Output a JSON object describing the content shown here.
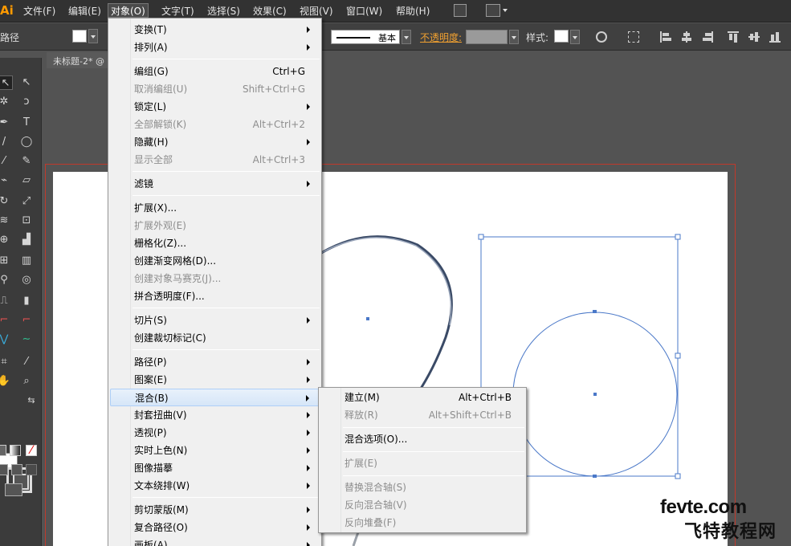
{
  "app": {
    "logo": "Ai"
  },
  "menubar": {
    "items": [
      "文件(F)",
      "编辑(E)",
      "对象(O)",
      "文字(T)",
      "选择(S)",
      "效果(C)",
      "视图(V)",
      "窗口(W)",
      "帮助(H)"
    ],
    "active": "对象(O)"
  },
  "controlbar": {
    "left_label": "路径",
    "stroke_style": "基本",
    "opacity_label": "不透明度:",
    "style_label": "样式:"
  },
  "document": {
    "tab_title": "未标题-2* @"
  },
  "object_menu": {
    "items": [
      {
        "label": "变换(T)",
        "shortcut": "",
        "submenu": true,
        "disabled": false
      },
      {
        "label": "排列(A)",
        "shortcut": "",
        "submenu": true,
        "disabled": false
      },
      {
        "label": "编组(G)",
        "shortcut": "Ctrl+G",
        "submenu": false,
        "disabled": false
      },
      {
        "label": "取消编组(U)",
        "shortcut": "Shift+Ctrl+G",
        "submenu": false,
        "disabled": true
      },
      {
        "label": "锁定(L)",
        "shortcut": "",
        "submenu": true,
        "disabled": false
      },
      {
        "label": "全部解锁(K)",
        "shortcut": "Alt+Ctrl+2",
        "submenu": false,
        "disabled": true
      },
      {
        "label": "隐藏(H)",
        "shortcut": "",
        "submenu": true,
        "disabled": false
      },
      {
        "label": "显示全部",
        "shortcut": "Alt+Ctrl+3",
        "submenu": false,
        "disabled": true
      },
      {
        "label": "滤镜",
        "shortcut": "",
        "submenu": true,
        "disabled": false
      },
      {
        "label": "扩展(X)...",
        "shortcut": "",
        "submenu": false,
        "disabled": false
      },
      {
        "label": "扩展外观(E)",
        "shortcut": "",
        "submenu": false,
        "disabled": true
      },
      {
        "label": "栅格化(Z)...",
        "shortcut": "",
        "submenu": false,
        "disabled": false
      },
      {
        "label": "创建渐变网格(D)...",
        "shortcut": "",
        "submenu": false,
        "disabled": false
      },
      {
        "label": "创建对象马赛克(J)...",
        "shortcut": "",
        "submenu": false,
        "disabled": true
      },
      {
        "label": "拼合透明度(F)...",
        "shortcut": "",
        "submenu": false,
        "disabled": false
      },
      {
        "label": "切片(S)",
        "shortcut": "",
        "submenu": true,
        "disabled": false
      },
      {
        "label": "创建裁切标记(C)",
        "shortcut": "",
        "submenu": false,
        "disabled": false
      },
      {
        "label": "路径(P)",
        "shortcut": "",
        "submenu": true,
        "disabled": false
      },
      {
        "label": "图案(E)",
        "shortcut": "",
        "submenu": true,
        "disabled": false
      },
      {
        "label": "混合(B)",
        "shortcut": "",
        "submenu": true,
        "disabled": false,
        "highlighted": true
      },
      {
        "label": "封套扭曲(V)",
        "shortcut": "",
        "submenu": true,
        "disabled": false
      },
      {
        "label": "透视(P)",
        "shortcut": "",
        "submenu": true,
        "disabled": false
      },
      {
        "label": "实时上色(N)",
        "shortcut": "",
        "submenu": true,
        "disabled": false
      },
      {
        "label": "图像描摹",
        "shortcut": "",
        "submenu": true,
        "disabled": false
      },
      {
        "label": "文本绕排(W)",
        "shortcut": "",
        "submenu": true,
        "disabled": false
      },
      {
        "label": "剪切蒙版(M)",
        "shortcut": "",
        "submenu": true,
        "disabled": false
      },
      {
        "label": "复合路径(O)",
        "shortcut": "",
        "submenu": true,
        "disabled": false
      },
      {
        "label": "画板(A)",
        "shortcut": "",
        "submenu": true,
        "disabled": false
      }
    ]
  },
  "blend_submenu": {
    "items": [
      {
        "label": "建立(M)",
        "shortcut": "Alt+Ctrl+B",
        "disabled": false
      },
      {
        "label": "释放(R)",
        "shortcut": "Alt+Shift+Ctrl+B",
        "disabled": true
      },
      {
        "label": "混合选项(O)...",
        "shortcut": "",
        "disabled": false
      },
      {
        "label": "扩展(E)",
        "shortcut": "",
        "disabled": true
      },
      {
        "label": "替换混合轴(S)",
        "shortcut": "",
        "disabled": true
      },
      {
        "label": "反向混合轴(V)",
        "shortcut": "",
        "disabled": true
      },
      {
        "label": "反向堆叠(F)",
        "shortcut": "",
        "disabled": true
      }
    ]
  },
  "watermark": {
    "line1": "fevte.com",
    "line2": "飞特教程网"
  },
  "colors": {
    "selection": "#4a78c8",
    "guide": "#c0392b",
    "menu_bg": "#f0f0f0",
    "highlight": "#d6e6f8"
  }
}
